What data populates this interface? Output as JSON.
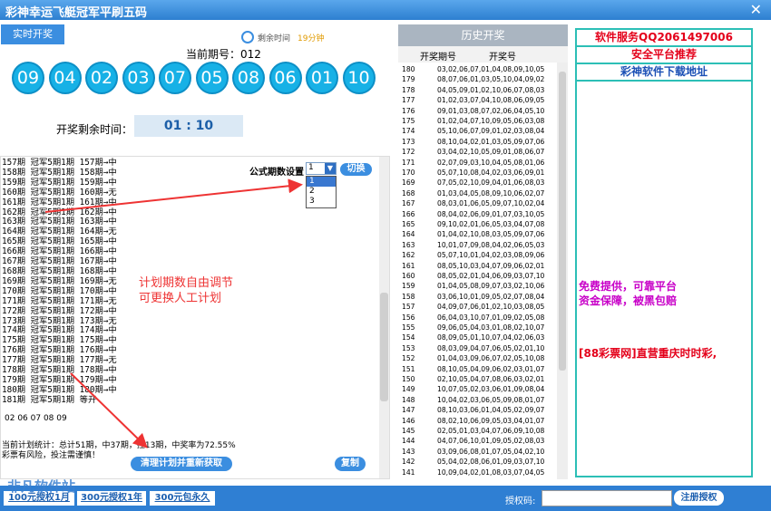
{
  "window": {
    "title": "彩神幸运飞艇冠军平刷五码",
    "close": "✕"
  },
  "live": {
    "tab_label": "实时开奖",
    "remain_label": "剩余时间",
    "remain_value": "19分钟",
    "period_label": "当前期号：012",
    "balls": [
      "09",
      "04",
      "02",
      "03",
      "07",
      "05",
      "08",
      "06",
      "01",
      "10"
    ],
    "countdown_label": "开奖剩余时间：",
    "countdown_value": "01 : 10"
  },
  "plan": {
    "lines": [
      "157期 冠军5期1期 157期→中",
      "158期 冠军5期1期 158期→中",
      "159期 冠军5期1期 159期→中",
      "160期 冠军5期1期 160期→无",
      "161期 冠军5期1期 161期→中",
      "162期 冠军5期1期 162期→中",
      "163期 冠军5期1期 163期→中",
      "164期 冠军5期1期 164期→无",
      "165期 冠军5期1期 165期→中",
      "166期 冠军5期1期 166期→中",
      "167期 冠军5期1期 167期→中",
      "168期 冠军5期1期 168期→中",
      "169期 冠军5期1期 169期→无",
      "170期 冠军5期1期 170期→中",
      "171期 冠军5期1期 171期→无",
      "172期 冠军5期1期 172期→中",
      "173期 冠军5期1期 173期→无",
      "174期 冠军5期1期 174期→中",
      "175期 冠军5期1期 175期→中",
      "176期 冠军5期1期 176期→中",
      "177期 冠军5期1期 177期→无",
      "178期 冠军5期1期 178期→中",
      "179期 冠军5期1期 179期→中",
      "180期 冠军5期1期 180期→中",
      "181期 冠军5期1期 等开"
    ],
    "numbers": "02 06 07 08 09",
    "stats_1": "当前计划统计：总计51期，中37期，挂13期，中奖率为72.55%",
    "stats_2": "彩票有风险，投注需谨慎！",
    "formula_label": "公式期数设置",
    "formula_value": "1",
    "formula_options": [
      "1",
      "2",
      "3"
    ],
    "switch_btn": "切换",
    "clear_btn": "清理计划并重新获取",
    "copy_btn": "复制",
    "annotation_1": "计划期数自由调节",
    "annotation_2": "可更换人工计划"
  },
  "history": {
    "title": "历史开奖",
    "col_period": "开奖期号",
    "col_number": "开奖号",
    "rows": [
      {
        "p": "180",
        "n": "03,02,06,07,01,04,08,09,10,05"
      },
      {
        "p": "179",
        "n": "08,07,06,01,03,05,10,04,09,02"
      },
      {
        "p": "178",
        "n": "04,05,09,01,02,10,06,07,08,03"
      },
      {
        "p": "177",
        "n": "01,02,03,07,04,10,08,06,09,05"
      },
      {
        "p": "176",
        "n": "09,01,03,08,07,02,06,04,05,10"
      },
      {
        "p": "175",
        "n": "01,02,04,07,10,09,05,06,03,08"
      },
      {
        "p": "174",
        "n": "05,10,06,07,09,01,02,03,08,04"
      },
      {
        "p": "173",
        "n": "08,10,04,02,01,03,05,09,07,06"
      },
      {
        "p": "172",
        "n": "03,04,02,10,05,09,01,08,06,07"
      },
      {
        "p": "171",
        "n": "02,07,09,03,10,04,05,08,01,06"
      },
      {
        "p": "170",
        "n": "05,07,10,08,04,02,03,06,09,01"
      },
      {
        "p": "169",
        "n": "07,05,02,10,09,04,01,06,08,03"
      },
      {
        "p": "168",
        "n": "01,03,04,05,08,09,10,06,02,07"
      },
      {
        "p": "167",
        "n": "08,03,01,06,05,09,07,10,02,04"
      },
      {
        "p": "166",
        "n": "08,04,02,06,09,01,07,03,10,05"
      },
      {
        "p": "165",
        "n": "09,10,02,01,06,05,03,04,07,08"
      },
      {
        "p": "164",
        "n": "01,04,02,10,08,03,05,09,07,06"
      },
      {
        "p": "163",
        "n": "10,01,07,09,08,04,02,06,05,03"
      },
      {
        "p": "162",
        "n": "05,07,10,01,04,02,03,08,09,06"
      },
      {
        "p": "161",
        "n": "08,05,10,03,04,07,09,06,02,01"
      },
      {
        "p": "160",
        "n": "08,05,02,01,04,06,09,03,07,10"
      },
      {
        "p": "159",
        "n": "01,04,05,08,09,07,03,02,10,06"
      },
      {
        "p": "158",
        "n": "03,06,10,01,09,05,02,07,08,04"
      },
      {
        "p": "157",
        "n": "04,09,07,06,01,02,10,03,08,05"
      },
      {
        "p": "156",
        "n": "06,04,03,10,07,01,09,02,05,08"
      },
      {
        "p": "155",
        "n": "09,06,05,04,03,01,08,02,10,07"
      },
      {
        "p": "154",
        "n": "08,09,05,01,10,07,04,02,06,03"
      },
      {
        "p": "153",
        "n": "08,03,09,04,07,06,05,02,01,10"
      },
      {
        "p": "152",
        "n": "01,04,03,09,06,07,02,05,10,08"
      },
      {
        "p": "151",
        "n": "08,10,05,04,09,06,02,03,01,07"
      },
      {
        "p": "150",
        "n": "02,10,05,04,07,08,06,03,02,01"
      },
      {
        "p": "149",
        "n": "10,07,05,02,03,06,01,09,08,04"
      },
      {
        "p": "148",
        "n": "10,04,02,03,06,05,09,08,01,07"
      },
      {
        "p": "147",
        "n": "08,10,03,06,01,04,05,02,09,07"
      },
      {
        "p": "146",
        "n": "08,02,10,06,09,05,03,04,01,07"
      },
      {
        "p": "145",
        "n": "02,05,01,03,04,07,06,09,10,08"
      },
      {
        "p": "144",
        "n": "04,07,06,10,01,09,05,02,08,03"
      },
      {
        "p": "143",
        "n": "03,09,06,08,01,07,05,04,02,10"
      },
      {
        "p": "142",
        "n": "05,04,02,08,06,01,09,03,07,10"
      },
      {
        "p": "141",
        "n": "10,09,04,02,01,08,03,07,04,05"
      }
    ]
  },
  "ad": {
    "row1": "软件服务QQ2061497006",
    "row2": "安全平台推荐",
    "row3": "彩神软件下载地址",
    "text1": "免费提供，可靠平台",
    "text2": "资金保障，被黑包赔",
    "text3": "[88彩票网]直营重庆时时彩,",
    "colors": {
      "row1": "#e4001a",
      "row2": "#e4001a",
      "row3": "#1a4fb5",
      "text_purple": "#c800c8"
    }
  },
  "bottom": {
    "btn1": "100元授权1月",
    "btn2": "300元授权1年",
    "btn3": "300元包永久",
    "auth_label": "授权码:",
    "register_btn": "注册授权",
    "watermark": "非凡软件站"
  }
}
